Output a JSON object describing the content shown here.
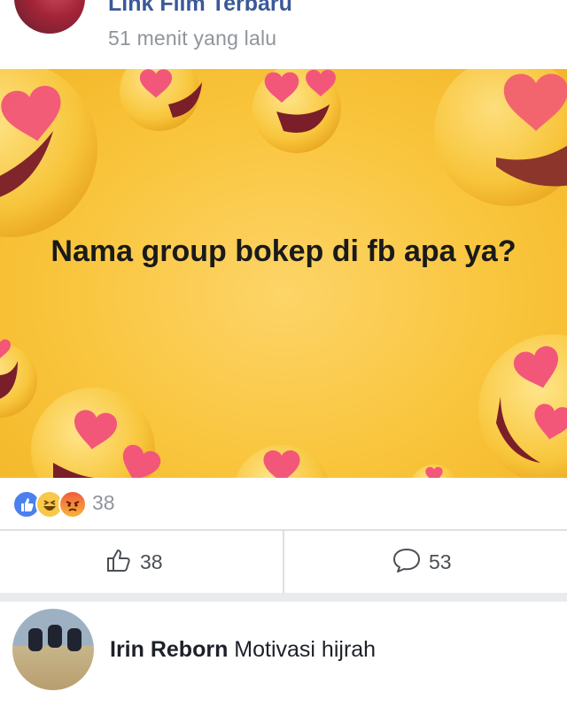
{
  "post": {
    "page_name": "Link Film Terbaru",
    "time": "51 menit yang lalu",
    "image_text": "Nama group bokep di fb apa ya?"
  },
  "reactions": {
    "types": [
      "like",
      "haha",
      "angry"
    ],
    "count": "38"
  },
  "actions": {
    "like_count": "38",
    "comment_count": "53"
  },
  "shared_post": {
    "author": "Irin Reborn",
    "text": "Motivasi hijrah"
  },
  "colors": {
    "link_blue": "#3b5998",
    "meta_gray": "#90949c",
    "emoji_yellow": "#f9c53c",
    "heart_pink": "#f2577a"
  }
}
